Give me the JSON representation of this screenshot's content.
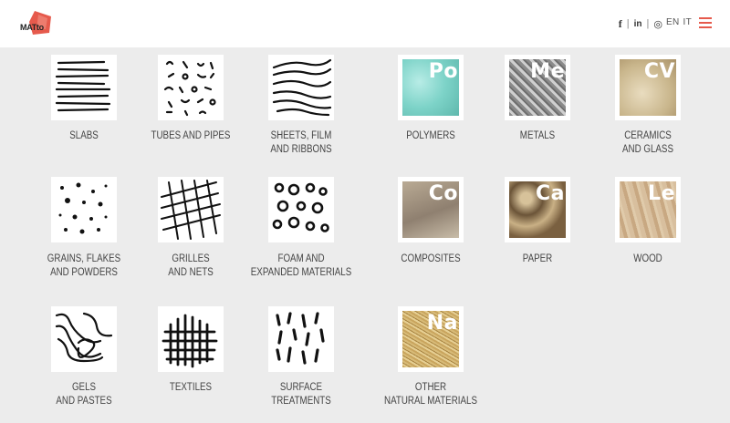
{
  "header": {
    "logo_text": "MATto",
    "social": {
      "facebook": "f",
      "linkedin": "in",
      "instagram": "◎",
      "sep": "|"
    },
    "lang": {
      "en": "EN",
      "it": "IT"
    }
  },
  "forms": [
    {
      "label_1": "SLABS",
      "label_2": ""
    },
    {
      "label_1": "TUBES AND PIPES",
      "label_2": ""
    },
    {
      "label_1": "SHEETS, FILM",
      "label_2": "AND RIBBONS"
    },
    {
      "label_1": "GRAINS, FLAKES",
      "label_2": "AND POWDERS"
    },
    {
      "label_1": "GRILLES",
      "label_2": "AND NETS"
    },
    {
      "label_1": "FOAM AND",
      "label_2": "EXPANDED MATERIALS"
    },
    {
      "label_1": "GELS",
      "label_2": "AND PASTES"
    },
    {
      "label_1": "TEXTILES",
      "label_2": ""
    },
    {
      "label_1": "SURFACE",
      "label_2": "TREATMENTS"
    }
  ],
  "materials": [
    {
      "symbol": "Po",
      "label_1": "POLYMERS",
      "label_2": ""
    },
    {
      "symbol": "Me",
      "label_1": "METALS",
      "label_2": ""
    },
    {
      "symbol": "CV",
      "label_1": "CERAMICS",
      "label_2": "AND GLASS"
    },
    {
      "symbol": "Co",
      "label_1": "COMPOSITES",
      "label_2": ""
    },
    {
      "symbol": "Ca",
      "label_1": "PAPER",
      "label_2": ""
    },
    {
      "symbol": "Le",
      "label_1": "WOOD",
      "label_2": ""
    },
    {
      "symbol": "Na",
      "label_1": "OTHER",
      "label_2": "NATURAL MATERIALS"
    }
  ],
  "colors": {
    "accent": "#e65a4c",
    "background": "#ececec"
  }
}
